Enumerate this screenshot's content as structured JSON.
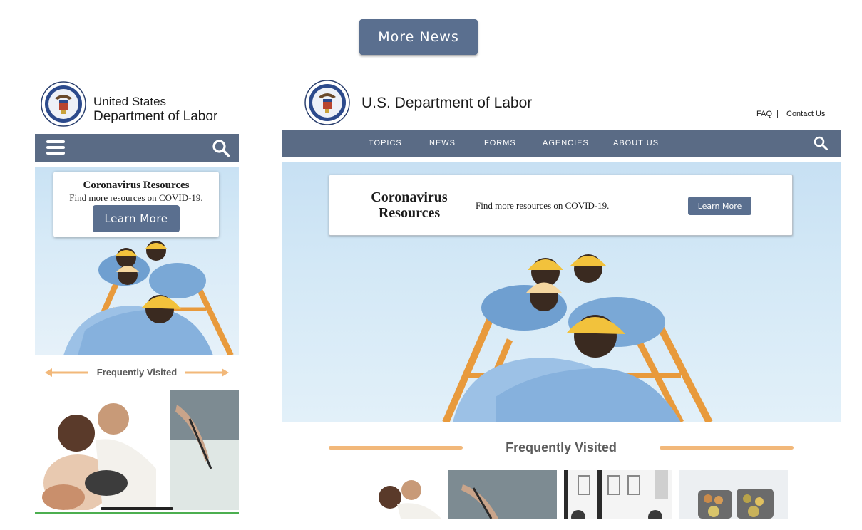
{
  "top": {
    "more_news_label": "More News"
  },
  "mobile": {
    "agency_line1": "United States",
    "agency_line2": "Department of Labor",
    "promo": {
      "title": "Coronavirus Resources",
      "text": "Find more resources on COVID-19.",
      "button": "Learn More"
    },
    "frequently_visited": "Frequently Visited"
  },
  "desktop": {
    "agency_name": "U.S. Department of Labor",
    "utility_links": {
      "faq": "FAQ",
      "separator": "|",
      "contact": "Contact Us"
    },
    "nav_items": [
      "TOPICS",
      "NEWS",
      "FORMS",
      "AGENCIES",
      "ABOUT US"
    ],
    "promo": {
      "title": "Coronavirus Resources",
      "text": "Find more resources on COVID-19.",
      "button": "Learn More"
    },
    "frequently_visited": "Frequently Visited"
  },
  "colors": {
    "nav_bar": "#5a6b85",
    "button": "#5a6f8f",
    "accent_orange": "#f2b87a",
    "sky": "#d3e8f6"
  },
  "icons": [
    "menu-icon",
    "search-icon",
    "arrow-left-icon",
    "arrow-right-icon",
    "dol-seal-icon"
  ]
}
